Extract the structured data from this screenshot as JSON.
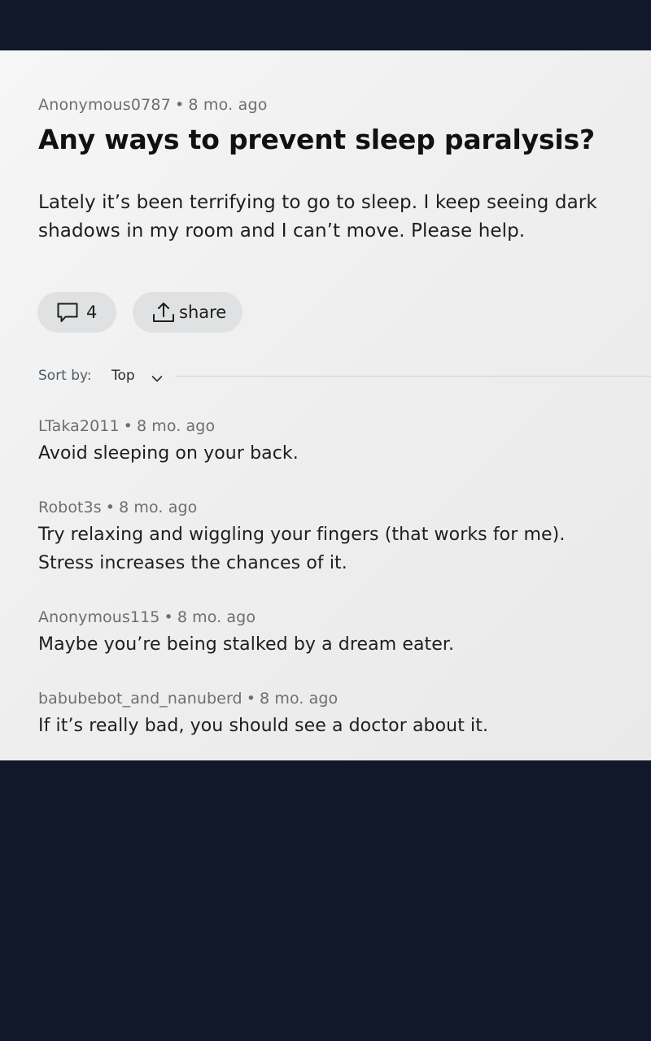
{
  "post": {
    "author": "Anonymous0787",
    "separator": "•",
    "time": "8 mo. ago",
    "title": "Any ways to prevent sleep paralysis?",
    "body": "Lately it’s been terrifying to go to sleep. I keep seeing dark shadows in my room and I can’t move. Please help."
  },
  "actions": {
    "comment_icon": "speech-bubble-icon",
    "comment_count": "4",
    "share_icon": "share-upload-icon",
    "share_label": "share"
  },
  "sort": {
    "label": "Sort by:",
    "value": "Top",
    "icon": "chevron-down-icon"
  },
  "comments": [
    {
      "author": "LTaka2011",
      "separator": "•",
      "time": "8 mo. ago",
      "body": "Avoid sleeping on your back."
    },
    {
      "author": "Robot3s",
      "separator": "•",
      "time": "8 mo. ago",
      "body": "Try relaxing and wiggling your fingers (that works for me). Stress increases the chances of it."
    },
    {
      "author": "Anonymous115",
      "separator": "•",
      "time": "8 mo. ago",
      "body": "Maybe you’re being stalked by a dream eater."
    },
    {
      "author": "babubebot_and_nanuberd",
      "separator": "•",
      "time": "8 mo. ago",
      "body": "If it’s really bad, you should see a doctor about it."
    }
  ],
  "colors": {
    "background": "#10182a",
    "panel": "#f2f2f2",
    "pill": "#e0e1e2",
    "meta_text": "#6e6e6e",
    "sort_label": "#4f5b66"
  }
}
